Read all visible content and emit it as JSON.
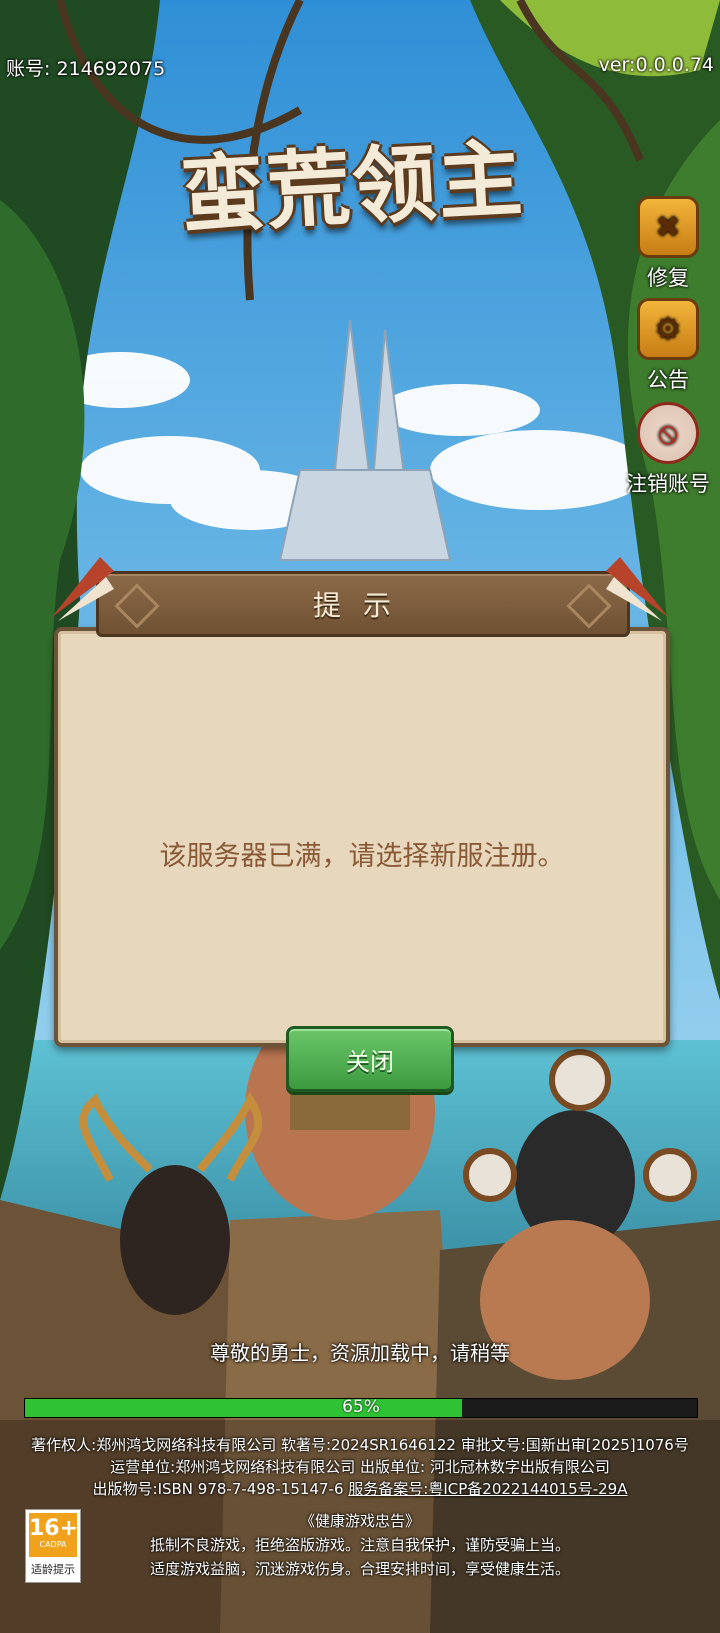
{
  "header": {
    "account_label": "账号:  214692075",
    "version": "ver:0.0.0.74"
  },
  "logo": {
    "text": "蛮荒领主"
  },
  "side_menu": [
    {
      "label": "修复",
      "icon": "wrench-icon"
    },
    {
      "label": "公告",
      "icon": "notice-board-icon"
    },
    {
      "label": "注销账号",
      "icon": "prohibited-icon"
    }
  ],
  "dialog": {
    "title": "提示",
    "message": "该服务器已满，请选择新服注册。",
    "close_label": "关闭"
  },
  "loading": {
    "message": "尊敬的勇士，资源加载中，请稍等",
    "percent": 65,
    "percent_label": "65%"
  },
  "legal": {
    "line1": "著作权人:郑州鸿戈网络科技有限公司 软著号:2024SR1646122 审批文号:国新出审[2025]1076号",
    "line2": "运营单位:郑州鸿戈网络科技有限公司 出版单位:  河北冠林数字出版有限公司",
    "line3_a": "出版物号:ISBN 978-7-498-15147-6 ",
    "line3_b": "服务备案号:粤ICP备2022144015号-29A",
    "advice_title": "《健康游戏忠告》",
    "advice_1": "抵制不良游戏，拒绝盗版游戏。注意自我保护，谨防受骗上当。",
    "advice_2": "适度游戏益脑，沉迷游戏伤身。合理安排时间，享受健康生活。"
  },
  "age_rating": {
    "age": "16+",
    "org": "CADPA",
    "label": "适龄提示"
  },
  "colors": {
    "progress": "#2ec234",
    "dialog_bg": "#e7d7bd",
    "button_green": "#3d9a3e"
  }
}
